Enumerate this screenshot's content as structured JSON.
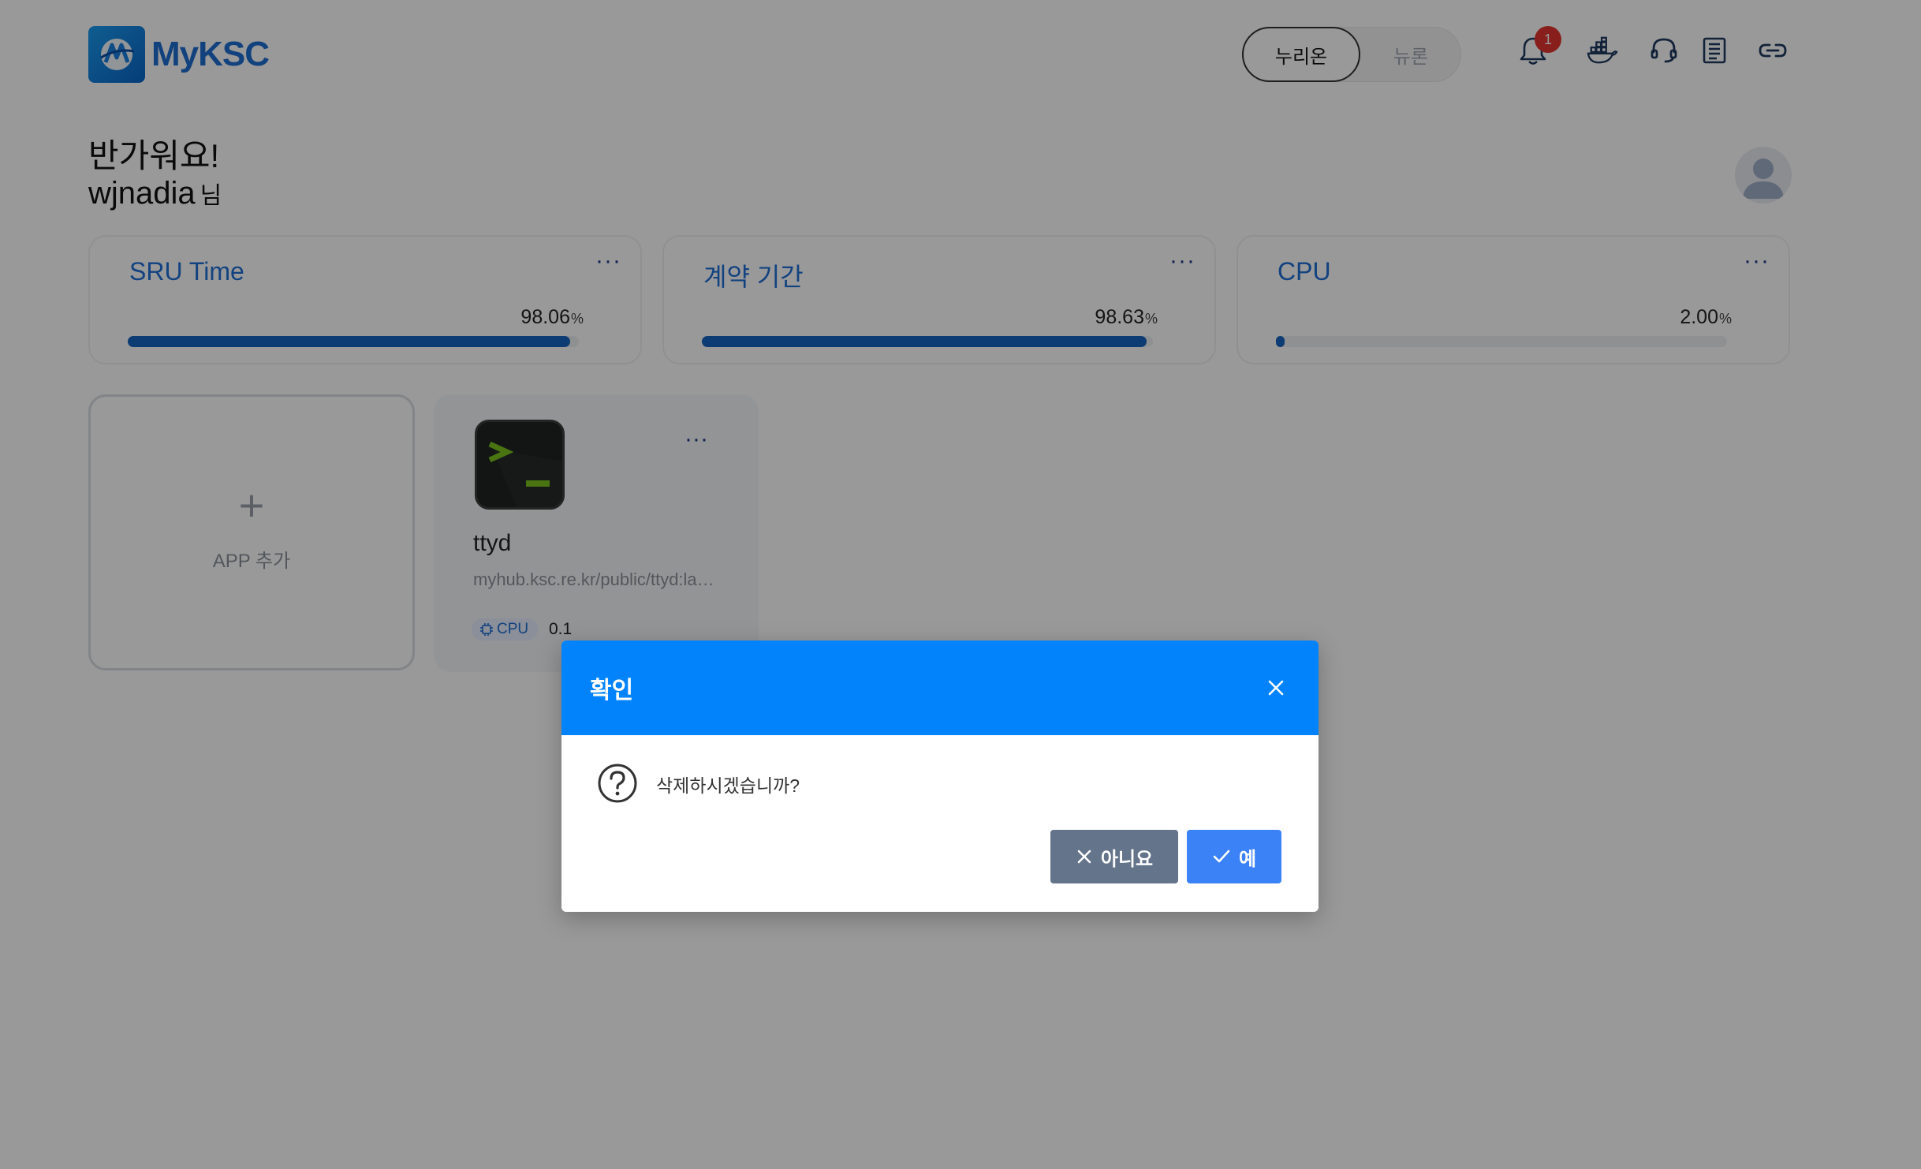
{
  "header": {
    "brand": "MyKSC",
    "segment": {
      "active": "누리온",
      "inactive": "뉴론"
    },
    "notification_count": "1",
    "icons": [
      "bell-icon",
      "docker-icon",
      "headset-icon",
      "document-icon",
      "link-icon"
    ]
  },
  "greeting": {
    "title": "반가워요!",
    "username": "wjnadia",
    "suffix": "님"
  },
  "stats": [
    {
      "title": "SRU Time",
      "value": "98.06",
      "unit": "%",
      "progress": 0.9806
    },
    {
      "title": "계약 기간",
      "value": "98.63",
      "unit": "%",
      "progress": 0.9863
    },
    {
      "title": "CPU",
      "value": "2.00",
      "unit": "%",
      "progress": 0.02
    }
  ],
  "menu_dots": "···",
  "apps": {
    "add_label": "APP 추가",
    "add_symbol": "+",
    "items": [
      {
        "name": "ttyd",
        "url": "myhub.ksc.re.kr/public/ttyd:latest",
        "resource_label": "CPU",
        "resource_value": "0.1"
      }
    ]
  },
  "dialog": {
    "title": "확인",
    "message": "삭제하시겠습니까?",
    "cancel_label": "아니요",
    "confirm_label": "예"
  },
  "colors": {
    "brand": "#1f6fd1",
    "progress": "#1565c0",
    "dialog_header": "#0283fc",
    "cancel": "#64748b",
    "confirm": "#3b82f6",
    "badge": "#e3342f"
  }
}
